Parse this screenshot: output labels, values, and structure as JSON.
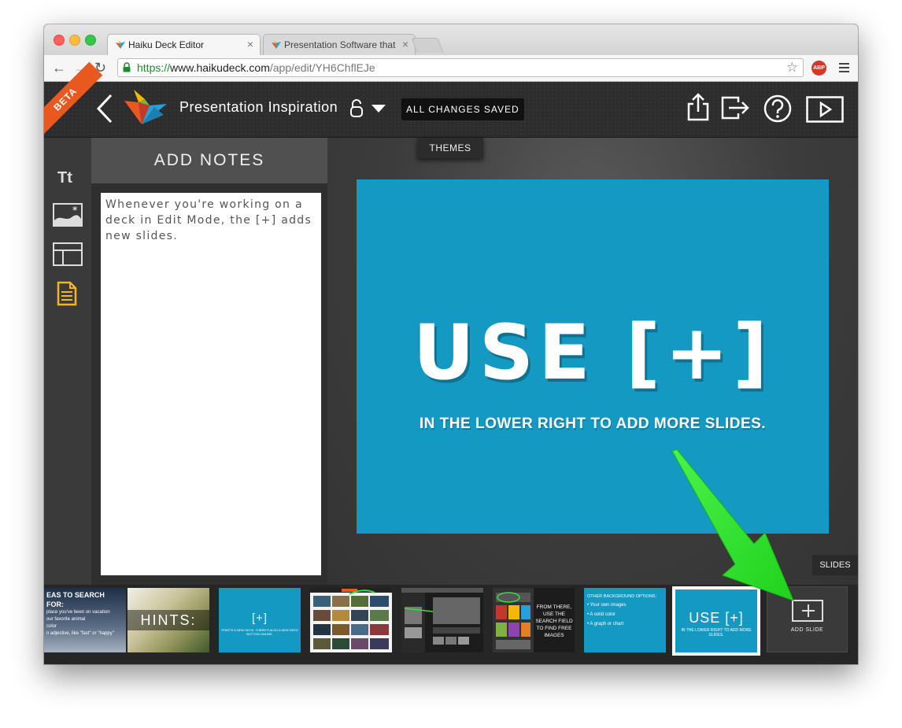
{
  "browser": {
    "tabs": [
      {
        "title": "Haiku Deck Editor",
        "active": true
      },
      {
        "title": "Presentation Software that",
        "active": false
      }
    ],
    "url_scheme": "https://",
    "url_host": "www.haikudeck.com",
    "url_path": "/app/edit/YH6ChflEJe",
    "adblock_label": "ABP"
  },
  "app": {
    "beta_label": "BETA",
    "deck_title": "Presentation Inspiration",
    "save_status": "ALL CHANGES SAVED",
    "themes_label": "THEMES",
    "slides_label": "SLIDES",
    "accent_color": "#1499c3",
    "beta_color": "#e8581f"
  },
  "tools": {
    "text_label": "Tt"
  },
  "notes": {
    "heading": "ADD NOTES",
    "text": "Whenever you're working on a deck in Edit Mode, the [+] adds new slides."
  },
  "slide": {
    "title": "USE [+]",
    "subtitle": "IN THE LOWER RIGHT TO ADD MORE SLIDES."
  },
  "filmstrip": {
    "thumb1": {
      "heading": "EAS TO SEARCH FOR:",
      "lines": [
        "place you've been on vacation",
        "our favorite animal",
        "color",
        "n adjective, like \"fast\" or \"happy\""
      ]
    },
    "thumb2": {
      "label": "HINTS:"
    },
    "thumb3": {
      "label": "[+]",
      "small": "STARTS A NEW DECK. THERE'S ALSO A NEW DECK BUTTON ONLINE."
    },
    "thumb6": {
      "text": "FROM THERE, USE THE SEARCH FIELD TO FIND FREE IMAGES"
    },
    "thumb7": {
      "heading": "OTHER BACKGROUND OPTIONS:",
      "items": [
        "• Your own images",
        "• A solid color",
        "• A graph or chart"
      ]
    },
    "thumb8": {
      "label": "USE [+]",
      "small": "IN THE LOWER RIGHT TO ADD MORE SLIDES."
    },
    "add_slide_label": "ADD SLIDE"
  }
}
